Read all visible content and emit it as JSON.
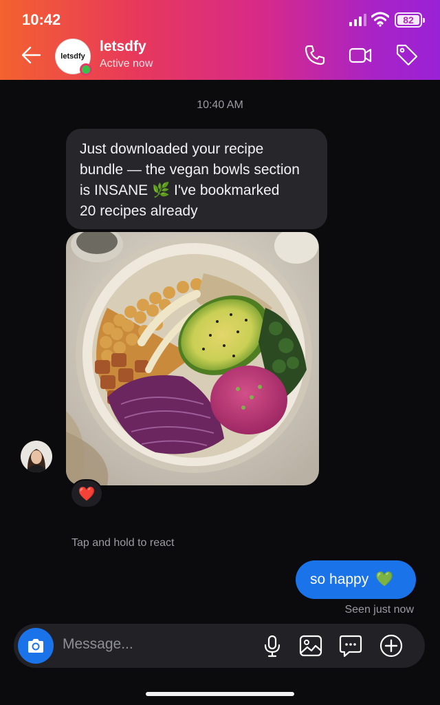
{
  "status_bar": {
    "time": "10:42",
    "battery": "82"
  },
  "header": {
    "avatar_text": "letsdfy",
    "name": "letsdfy",
    "status": "Active now",
    "icons": [
      "back-arrow-icon",
      "phone-icon",
      "video-camera-icon",
      "tag-icon"
    ]
  },
  "chat": {
    "timestamp": "10:40 AM",
    "incoming_message": {
      "lines": [
        "Just downloaded your recipe",
        "bundle — the vegan bowls section",
        "is INSANE 🌿 I've bookmarked",
        "20 recipes already"
      ],
      "reaction": "❤️"
    },
    "tap_hint": "Tap and hold to react",
    "outgoing_message": {
      "text": "so happy",
      "emoji": "💚"
    },
    "seen": "Seen just now"
  },
  "composer": {
    "placeholder": "Message...",
    "icons": [
      "camera-icon",
      "microphone-icon",
      "image-icon",
      "chat-bubble-icon",
      "plus-circle-icon"
    ]
  },
  "colors": {
    "accent": "#1a73e8",
    "bubble_in": "#26262b",
    "background": "#0b0b0d"
  }
}
